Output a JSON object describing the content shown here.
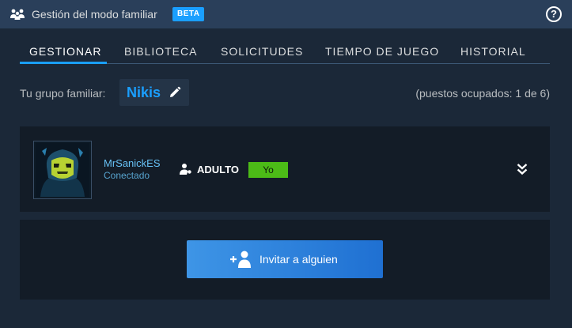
{
  "window": {
    "title": "Gestión del modo familiar",
    "badge": "BETA",
    "help_glyph": "?"
  },
  "tabs": [
    {
      "label": "GESTIONAR",
      "active": true
    },
    {
      "label": "BIBLIOTECA",
      "active": false
    },
    {
      "label": "SOLICITUDES",
      "active": false
    },
    {
      "label": "TIEMPO DE JUEGO",
      "active": false
    },
    {
      "label": "HISTORIAL",
      "active": false
    }
  ],
  "group": {
    "label": "Tu grupo familiar:",
    "name": "Nikis",
    "seats": "(puestos ocupados: 1 de 6)"
  },
  "member": {
    "name": "MrSanickES",
    "status": "Conectado",
    "role": "ADULTO",
    "self_tag": "Yo"
  },
  "invite": {
    "label": "Invitar a alguien"
  },
  "colors": {
    "background": "#1b2838",
    "titlebar": "#2a3f5a",
    "accent": "#1a9fff",
    "card": "#131c27",
    "self_tag": "#4cbb17"
  },
  "icons": {
    "title": "family-icon",
    "help": "help-icon",
    "edit": "pencil-icon",
    "role": "adult-user-icon",
    "expand": "chevron-double-down-icon",
    "invite": "add-user-icon"
  }
}
